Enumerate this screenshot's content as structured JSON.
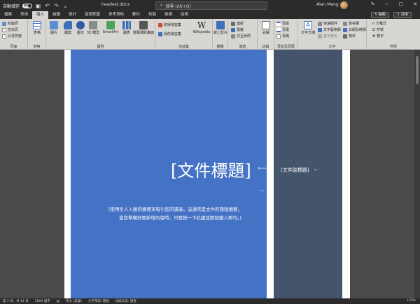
{
  "titlebar": {
    "autosave_label": "自動儲存",
    "autosave_state": "關閉",
    "doc_title": "headest.docx",
    "search_placeholder": "搜尋 (Alt+Q)",
    "user_name": "Alan Meng"
  },
  "menu": {
    "tabs": [
      "檔案",
      "常用",
      "插入",
      "繪圖",
      "設計",
      "版面配置",
      "參考資料",
      "郵件",
      "校閱",
      "檢視",
      "說明"
    ],
    "active_index": 2,
    "edit_label": "編輯",
    "share_label": "共用"
  },
  "ribbon": {
    "pages_group": {
      "label": "頁面",
      "items": [
        "封面頁",
        "空白頁",
        "分頁符號"
      ]
    },
    "tables_group": {
      "label": "表格",
      "button": "表格"
    },
    "illustrations_group": {
      "label": "圖例",
      "buttons": [
        "圖片",
        "圖案",
        "圖示",
        "3D 模型",
        "SmartArt",
        "圖表",
        "螢幕擷取畫面"
      ]
    },
    "addins_group": {
      "label": "增益集",
      "items": [
        "取得增益集",
        "我的增益集"
      ],
      "wiki": "Wikipedia"
    },
    "media_group": {
      "label": "媒體",
      "button": "線上影片"
    },
    "links_group": {
      "label": "連結",
      "items": [
        "連結",
        "書籤",
        "交互參照"
      ]
    },
    "comments_group": {
      "label": "註解",
      "button": "註解"
    },
    "header_group": {
      "label": "頁首及頁尾",
      "items": [
        "頁首",
        "頁尾",
        "頁碼"
      ]
    },
    "text_group": {
      "label": "文字",
      "items": [
        "文字方塊",
        "快速組件",
        "文字藝術師",
        "首字放大",
        "簽名欄",
        "日期及時間",
        "物件"
      ]
    },
    "symbols_group": {
      "label": "符號",
      "items": [
        "方程式",
        "符號",
        "數字"
      ]
    }
  },
  "document": {
    "title_placeholder": "[文件標題]",
    "subtitle_placeholder": "[文件副標題]",
    "abstract_line1": "[使用引人入勝的摘要來吸引您的讀者。這通常是文件的簡短摘要。",
    "abstract_line2": "當您準備好要新增內容時，只要按一下此處並開始鍵入即可。]"
  },
  "status": {
    "page": "第 1 頁，共 14 頁",
    "words": "5800 個字",
    "language": "英文 (美國)",
    "prediction": "文字預測: 開啟",
    "accessibility": "協助工具: 調查",
    "zoom": "120%"
  },
  "colors": {
    "blue_panel": "#4472c4",
    "dark_panel": "#44546a",
    "titlebar": "#2b2b2b",
    "ribbon": "#d8d6d3"
  }
}
